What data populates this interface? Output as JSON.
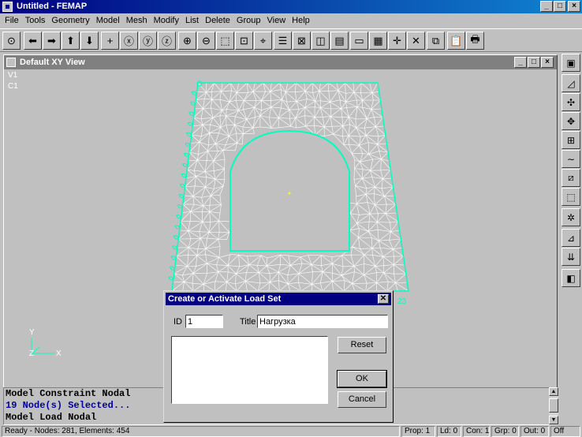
{
  "app": {
    "title": "Untitled - FEMAP",
    "win_buttons": [
      "_",
      "□",
      "×"
    ]
  },
  "menu": [
    {
      "label": "File",
      "disabled": false
    },
    {
      "label": "Tools",
      "disabled": false
    },
    {
      "label": "Geometry",
      "disabled": false
    },
    {
      "label": "Model",
      "disabled": false
    },
    {
      "label": "Mesh",
      "disabled": false
    },
    {
      "label": "Modify",
      "disabled": false
    },
    {
      "label": "List",
      "disabled": false
    },
    {
      "label": "Delete",
      "disabled": false
    },
    {
      "label": "Group",
      "disabled": false
    },
    {
      "label": "View",
      "disabled": false
    },
    {
      "label": "Help",
      "disabled": false
    }
  ],
  "toolbar_icons": [
    "select-icon",
    "arrow-left-icon",
    "arrow-right-icon",
    "arrow-up-icon",
    "arrow-down-icon",
    "plus-icon",
    "rotate-x-icon",
    "rotate-y-icon",
    "rotate-z-icon",
    "zoom-in-icon",
    "zoom-out-icon",
    "zoom-box-icon",
    "fit-view-icon",
    "center-icon",
    "layers-icon",
    "element-icon",
    "solid-icon",
    "surface-icon",
    "window-icon",
    "mesh-grid-icon",
    "crosshair-icon",
    "close-x-icon",
    "copy-icon",
    "paste-icon",
    "print-icon"
  ],
  "rightbar_icons": [
    "save-icon",
    "point-icon",
    "node-icon",
    "node-move-icon",
    "element-add-icon",
    "curve-icon",
    "surface-icon",
    "solid-icon",
    "mesh-icon",
    "constraint-icon",
    "load-icon",
    "view-window-icon"
  ],
  "view": {
    "title": "Default XY View",
    "labels": [
      "V1",
      "C1"
    ],
    "node_label": "23",
    "axis_y": "Y",
    "axis_x": "X",
    "axis_z": "Z",
    "mesh_color": "#ffffff",
    "edge_color": "#00ffc0"
  },
  "messages": [
    {
      "text": "Model Constraint Nodal",
      "color": "#000000"
    },
    {
      "text": "19 Node(s) Selected...",
      "color": "#0000a0"
    },
    {
      "text": "Model Load Nodal",
      "color": "#000000"
    }
  ],
  "status": {
    "main": "Ready - Nodes: 281,  Elements: 454",
    "prop": "Prop: 1",
    "ld": "Ld: 0",
    "con": "Con: 1",
    "grp": "Grp: 0",
    "out": "Out: 0",
    "mode": "Off"
  },
  "dialog": {
    "title": "Create or Activate Load Set",
    "id_label": "ID",
    "id_value": "1",
    "title_label": "Title",
    "title_value": "Нагрузка",
    "reset_label": "Reset",
    "ok_label": "OK",
    "cancel_label": "Cancel"
  }
}
